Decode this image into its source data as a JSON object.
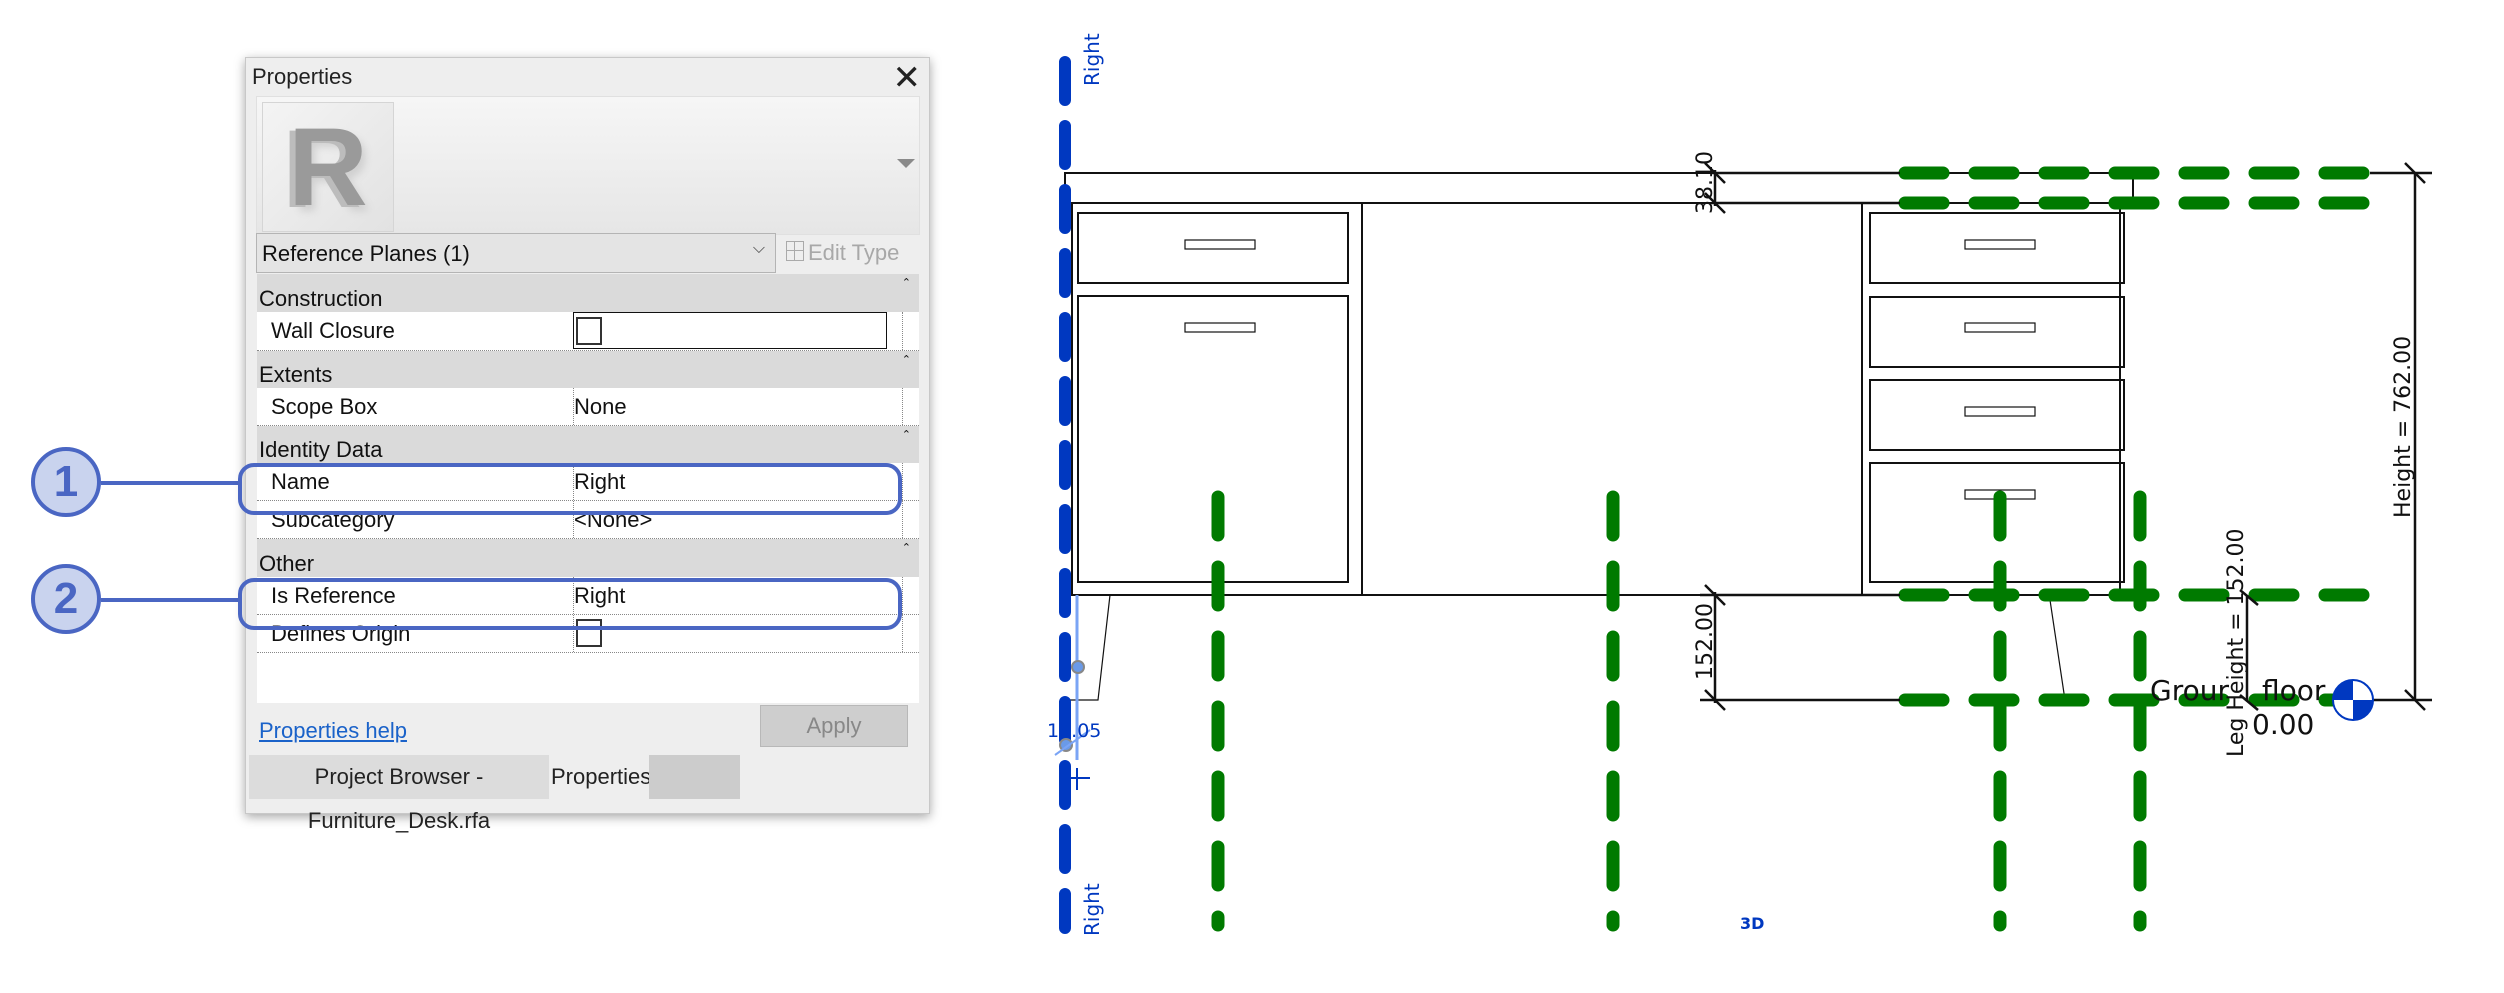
{
  "properties_panel": {
    "title": "Properties",
    "close_icon": "close-icon",
    "type_selector": "Reference Planes (1)",
    "edit_type": "Edit Type",
    "groups": {
      "construction": "Construction",
      "extents": "Extents",
      "identity": "Identity Data",
      "other": "Other"
    },
    "rows": {
      "wall_closure": {
        "label": "Wall Closure",
        "checked": false
      },
      "scope_box": {
        "label": "Scope Box",
        "value": "None"
      },
      "name": {
        "label": "Name",
        "value": "Right"
      },
      "subcategory": {
        "label": "Subcategory",
        "value": "<None>"
      },
      "is_reference": {
        "label": "Is Reference",
        "value": "Right"
      },
      "defines_origin": {
        "label": "Defines Origin",
        "checked": false
      }
    },
    "help_link": "Properties help",
    "apply_button": "Apply",
    "tabs": {
      "project_browser": "Project Browser - Furniture_Desk.rfa",
      "properties": "Properties"
    }
  },
  "callouts": [
    "1",
    "2"
  ],
  "drawing": {
    "ref_plane_label_top": "Right",
    "ref_plane_label_bottom": "Right",
    "temp_dimension": "19.05",
    "dim_top_thickness": "38.10",
    "dim_leg": "152.00",
    "dim_height": "Height = 762.00",
    "dim_leg_height": "Leg Height = 152.00",
    "level_name": "Ground floor",
    "level_name_visible": "Grour",
    "level_name_visible_2": "floor",
    "level_elevation": "0.00",
    "view_label": "3D"
  },
  "colors": {
    "callout": "#4a66c3",
    "selected_ref_plane": "#0038c0",
    "ref_plane": "#007a00",
    "link": "#1a62c9"
  }
}
